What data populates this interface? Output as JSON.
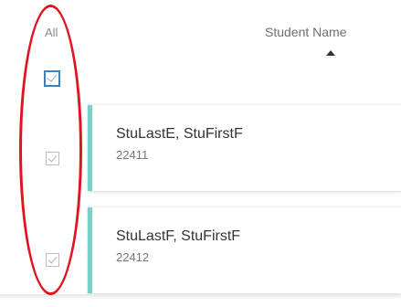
{
  "header": {
    "select_all_label": "All",
    "student_name_column": "Student Name"
  },
  "select_all": {
    "checked": true
  },
  "students": [
    {
      "name": "StuLastE, StuFirstF",
      "id": "22411",
      "checked": true
    },
    {
      "name": "StuLastF, StuFirstF",
      "id": "22412",
      "checked": true
    }
  ],
  "colors": {
    "accent_bar": "#79d1c6",
    "select_all_checkbox_border": "#3e7fc1",
    "highlight_ellipse": "#e0141e"
  },
  "icons": {
    "sort": "sort-ascending-icon",
    "check": "checkmark-icon"
  }
}
